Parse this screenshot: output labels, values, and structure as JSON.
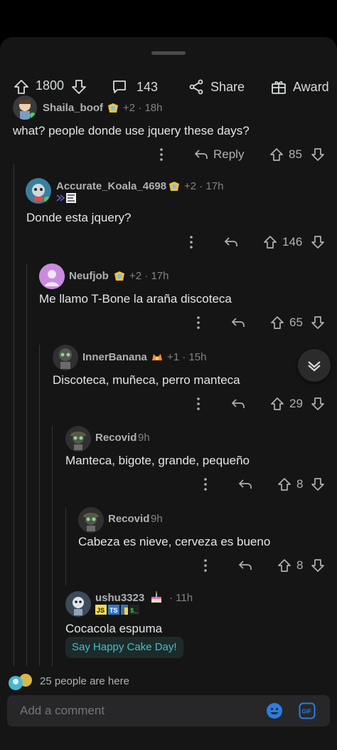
{
  "post_actions": {
    "upvotes": "1800",
    "comments": "143",
    "share_label": "Share",
    "award_label": "Award"
  },
  "comments": [
    {
      "username": "Shaila_boof",
      "awards": "+2",
      "time": "· 18h",
      "body": "what? people donde use jquery these days?",
      "reply_label": "Reply",
      "votes": "85"
    },
    {
      "username": "Accurate_Koala_4698",
      "awards": "+2",
      "time": "· 17h",
      "body": "Donde esta jquery?",
      "votes": "146"
    },
    {
      "username": "Neufjob",
      "awards": "+2",
      "time": "· 17h",
      "body": "Me llamo T-Bone la araña discoteca",
      "votes": "65"
    },
    {
      "username": "InnerBanana",
      "awards": "+1",
      "time": "· 15h",
      "body": "Discoteca, muñeca, perro manteca",
      "votes": "29"
    },
    {
      "username": "Recovid",
      "time": "9h",
      "body": "Manteca, bigote, grande, pequeño",
      "votes": "8"
    },
    {
      "username": "Recovid",
      "time": "9h",
      "body": "Cabeza es nieve, cerveza es bueno",
      "votes": "8"
    },
    {
      "username": "ushu3323",
      "time": "· 11h",
      "body": "Cocacola espuma",
      "cake_day": "Say Happy Cake Day!",
      "flair": "JS TS $_"
    }
  ],
  "presence": {
    "text": "25 people are here"
  },
  "composer": {
    "placeholder": "Add a comment"
  },
  "icons": [
    "upvote-icon",
    "downvote-icon",
    "comment-icon",
    "share-icon",
    "award-icon",
    "more-icon",
    "reply-icon",
    "chevron-down-icon",
    "emoji-icon",
    "gif-icon"
  ],
  "colors": {
    "background": "#151515",
    "text": "#d7dadc",
    "muted": "#818384",
    "accent_teal": "#3fc1c9",
    "icon_blue": "#2a7de1"
  }
}
